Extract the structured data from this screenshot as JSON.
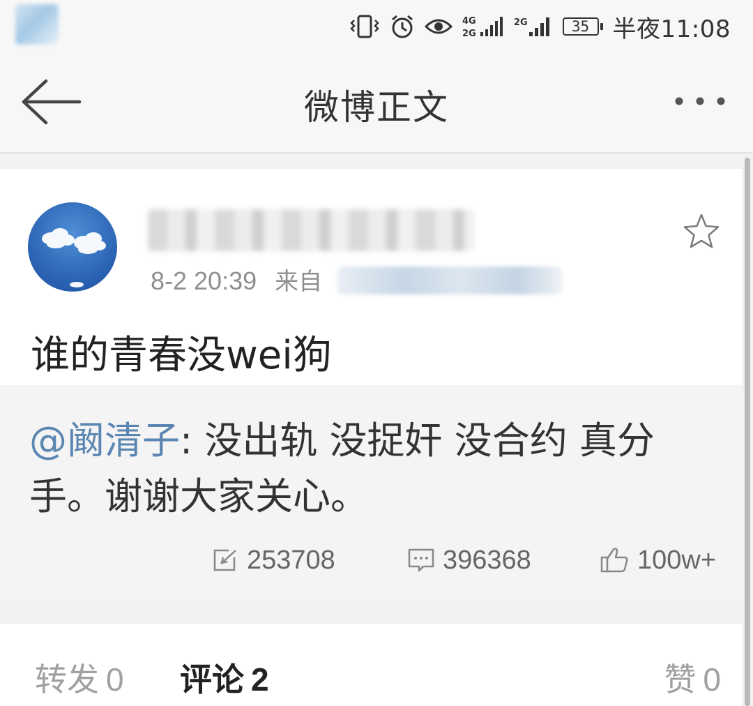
{
  "status_bar": {
    "time": "半夜11:08",
    "battery": "35",
    "network_1": "4G 2G",
    "network_2": "2G",
    "icons": [
      "vibrate-icon",
      "alarm-icon",
      "eye-icon",
      "signal-icon",
      "signal-icon",
      "battery-icon"
    ]
  },
  "header": {
    "title": "微博正文",
    "back_icon": "back-arrow-icon",
    "more_icon": "more-dots-icon"
  },
  "post": {
    "meta_time": "8-2 20:39",
    "meta_from": "来自",
    "text": "谁的青春没wei狗",
    "star_icon": "star-icon"
  },
  "retweet": {
    "mention": "@阚清子",
    "text": ": 没出轨 没捉奸 没合约 真分手。谢谢大家关心。",
    "reposts": "253708",
    "comments": "396368",
    "likes": "100w+"
  },
  "tabs": {
    "repost_label": "转发",
    "repost_count": "0",
    "comment_label": "评论",
    "comment_count": "2",
    "like_label": "赞",
    "like_count": "0"
  },
  "colors": {
    "mention": "#5b86b1",
    "background": "#f2f2f2",
    "card": "#ffffff"
  }
}
